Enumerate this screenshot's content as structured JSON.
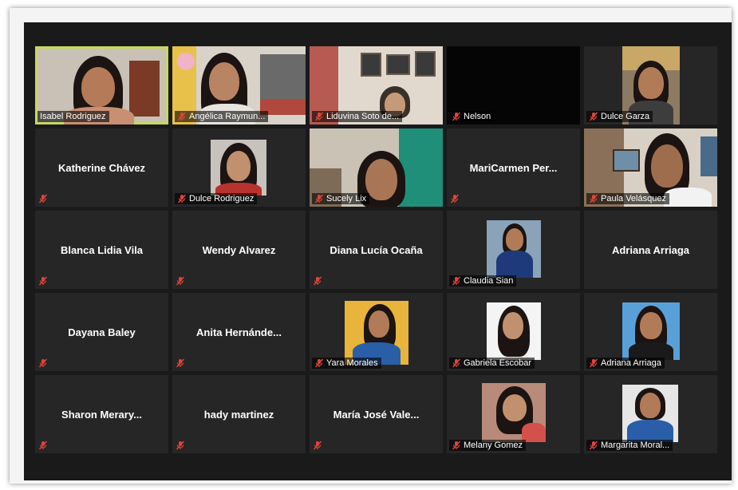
{
  "participants": [
    {
      "name": "Isabel Rodriguez",
      "video": true,
      "active": true,
      "muted": false
    },
    {
      "name": "Angélica Raymun...",
      "video": true,
      "muted": true
    },
    {
      "name": "Liduvina Soto de...",
      "video": true,
      "muted": true
    },
    {
      "name": "Nelson",
      "video": true,
      "muted": true
    },
    {
      "name": "Dulce Garza",
      "video": true,
      "muted": true
    },
    {
      "name": "Katherine Chávez",
      "video": false,
      "muted": true
    },
    {
      "name": "Dulce Rodriguez",
      "video": false,
      "photo": true,
      "muted": true
    },
    {
      "name": "Sucely Lix",
      "video": true,
      "muted": true
    },
    {
      "name": "MariCarmen Per...",
      "video": false,
      "muted": true
    },
    {
      "name": "Paula Velásquez",
      "video": true,
      "muted": true
    },
    {
      "name": "Blanca Lidia Vila",
      "video": false,
      "muted": true
    },
    {
      "name": "Wendy Alvarez",
      "video": false,
      "muted": true
    },
    {
      "name": "Diana Lucía Ocaña",
      "video": false,
      "muted": true
    },
    {
      "name": "Claudia Sian",
      "video": false,
      "photo": true,
      "muted": true
    },
    {
      "name": "Adriana Arriaga",
      "video": false,
      "muted": false
    },
    {
      "name": "Dayana Baley",
      "video": false,
      "muted": true
    },
    {
      "name": "Anita  Hernánde...",
      "video": false,
      "muted": true
    },
    {
      "name": "Yara Morales",
      "video": false,
      "photo": true,
      "muted": true
    },
    {
      "name": "Gabriela Escobar",
      "video": false,
      "photo": true,
      "muted": true
    },
    {
      "name": "Adriana Arriaga",
      "video": false,
      "photo": true,
      "muted": true
    },
    {
      "name": "Sharon  Merary...",
      "video": false,
      "muted": true
    },
    {
      "name": "hady martinez",
      "video": false,
      "muted": true
    },
    {
      "name": "María José  Vale...",
      "video": false,
      "muted": true
    },
    {
      "name": "Melany Gomez",
      "video": false,
      "photo": true,
      "muted": true
    },
    {
      "name": "Margarita Moral...",
      "video": false,
      "photo": true,
      "muted": true
    }
  ],
  "colors": {
    "active_border": "#c6d95f",
    "tile_bg": "#262626",
    "muted_icon": "#e0443a"
  },
  "icons": {
    "muted": "mic-muted-icon"
  }
}
